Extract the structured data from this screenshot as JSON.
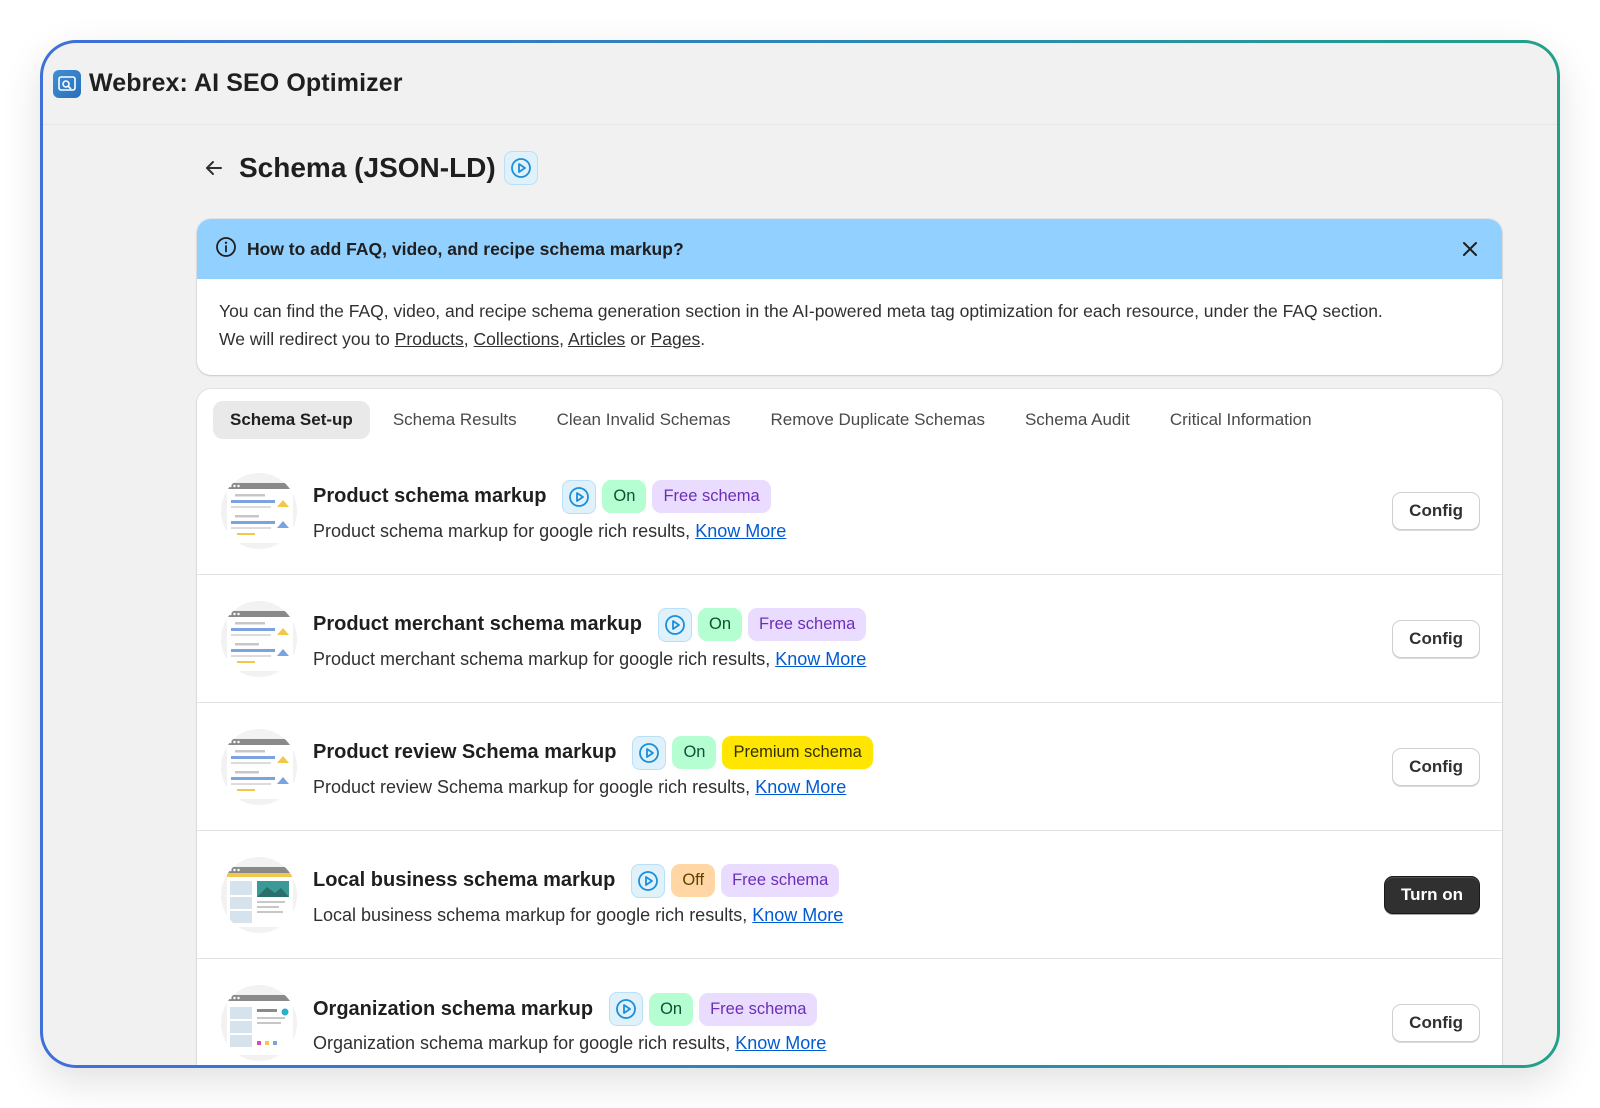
{
  "app": {
    "title": "Webrex: AI SEO Optimizer",
    "logo_icon": "seo-magnifier-icon"
  },
  "page": {
    "title": "Schema (JSON-LD)"
  },
  "banner": {
    "title": "How to add FAQ, video, and recipe schema markup?",
    "text_1": "You can find the FAQ, video, and recipe schema generation section in the AI-powered meta tag optimization for each resource, under the FAQ section.",
    "text_2": "We will redirect you to",
    "link_products": "Products",
    "link_collections": "Collections",
    "link_articles": "Articles",
    "sep_or": "or",
    "link_pages": "Pages"
  },
  "tabs": [
    {
      "label": "Schema Set-up",
      "active": true
    },
    {
      "label": "Schema Results"
    },
    {
      "label": "Clean Invalid Schemas"
    },
    {
      "label": "Remove Duplicate Schemas"
    },
    {
      "label": "Schema Audit"
    },
    {
      "label": "Critical Information"
    }
  ],
  "schemas": [
    {
      "title": "Product schema markup",
      "status": "On",
      "tier": "Free schema",
      "description": "Product schema markup for google rich results,",
      "link": "Know More",
      "action": "Config"
    },
    {
      "title": "Product merchant schema markup",
      "status": "On",
      "tier": "Free schema",
      "description": "Product merchant schema markup for google rich results,",
      "link": "Know More",
      "action": "Config"
    },
    {
      "title": "Product review Schema markup",
      "status": "On",
      "tier": "Premium schema",
      "description": "Product review Schema markup for google rich results,",
      "link": "Know More",
      "action": "Config"
    },
    {
      "title": "Local business schema markup",
      "status": "Off",
      "tier": "Free schema",
      "description": "Local business schema markup for google rich results,",
      "link": "Know More",
      "action": "Turn on"
    },
    {
      "title": "Organization schema markup",
      "status": "On",
      "tier": "Free schema",
      "description": "Organization schema markup for google rich results,",
      "link": "Know More",
      "action": "Config"
    }
  ],
  "colors": {
    "banner_bg": "#91d0ff",
    "badge_on": "#b4fed2",
    "badge_off": "#ffd6a4",
    "badge_free": "#eadcff",
    "badge_premium": "#ffe600",
    "link": "#005bd3",
    "primary_button": "#303030"
  }
}
